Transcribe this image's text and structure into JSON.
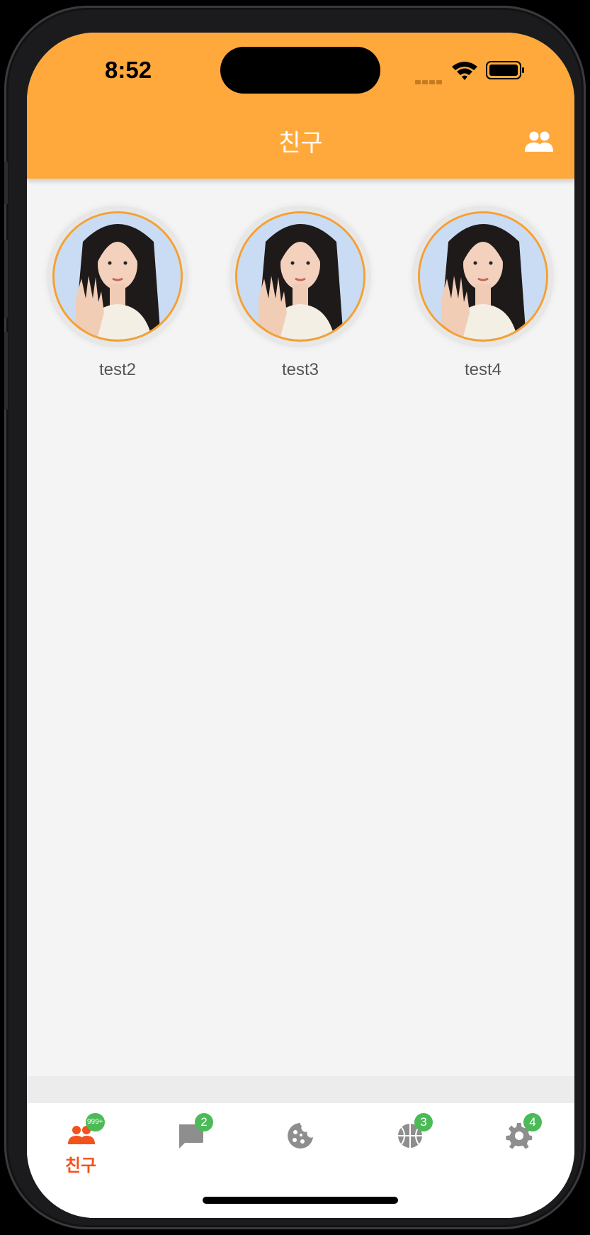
{
  "status_bar": {
    "time": "8:52"
  },
  "app_bar": {
    "title": "친구",
    "background_color": "#ffa93c",
    "action_icon": "people-icon"
  },
  "friends": [
    {
      "name": "test2"
    },
    {
      "name": "test3"
    },
    {
      "name": "test4"
    }
  ],
  "tab_bar": {
    "active_color": "#f4511e",
    "inactive_color": "#8e8e8e",
    "badge_color": "#4cbb57",
    "tabs": [
      {
        "icon": "people-icon",
        "label": "친구",
        "badge": "999+",
        "active": true
      },
      {
        "icon": "chat-bubble-icon",
        "badge": "2",
        "active": false
      },
      {
        "icon": "cookie-icon",
        "active": false
      },
      {
        "icon": "basketball-icon",
        "badge": "3",
        "active": false
      },
      {
        "icon": "gear-icon",
        "badge": "4",
        "active": false
      }
    ]
  }
}
